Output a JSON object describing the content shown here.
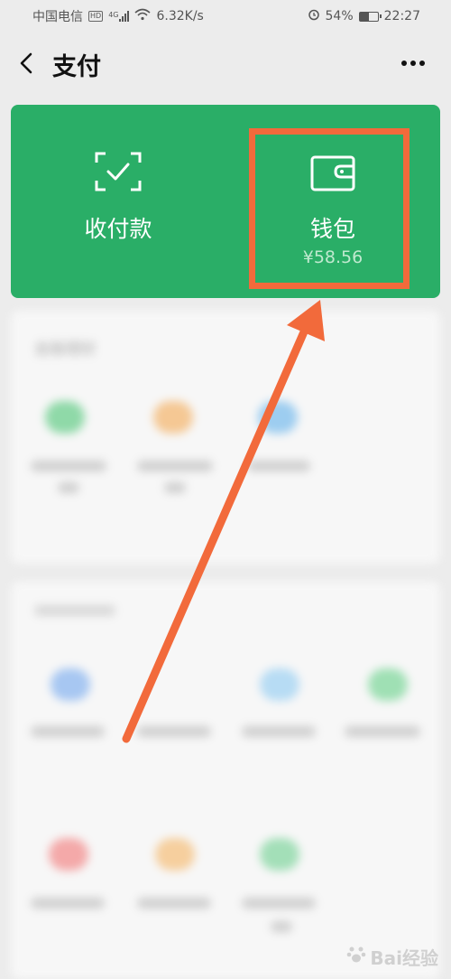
{
  "status_bar": {
    "carrier": "中国电信",
    "hd": "HD",
    "network": "4G",
    "speed": "6.32K/s",
    "battery": "54%",
    "battery_level": 0.54,
    "time": "22:27"
  },
  "header": {
    "title": "支付",
    "back_icon": "chevron-left-icon",
    "more_icon": "more-dots-icon"
  },
  "pay_card": {
    "color": "#2aae67",
    "receive": {
      "label": "收付款",
      "icon": "scan-check-icon"
    },
    "wallet": {
      "label": "钱包",
      "amount": "¥58.56",
      "icon": "wallet-icon"
    }
  },
  "sections": {
    "finance_title": "金融理财"
  },
  "annotation": {
    "color": "#f26a3b"
  },
  "watermark": {
    "text": "Bai经验"
  }
}
